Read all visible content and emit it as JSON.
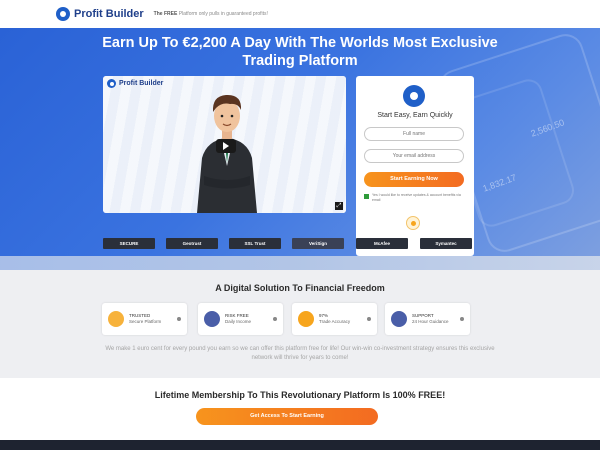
{
  "brand": {
    "name": "Profit Builder",
    "tagline_strong": "The FREE",
    "tagline_rest": "Platform only pulls in guaranteed profits!"
  },
  "hero": {
    "title_line1": "Earn Up To €2,200 A Day With The Worlds Most Exclusive",
    "title_line2": "Trading Platform",
    "deco_numbers": [
      "2,560.50",
      "1,832.17"
    ]
  },
  "video": {
    "logo_text": "Profit Builder"
  },
  "form": {
    "title": "Start Easy, Earn Quickly",
    "name_placeholder": "Full name",
    "email_placeholder": "Your email address",
    "submit_label": "Start Earning Now",
    "consent_text": "Yes I would like to receive updates & account benefits via email"
  },
  "trust_logos": [
    "SECURE",
    "Geotrust",
    "SSL Trust",
    "VeriSign",
    "McAfee",
    "Symantec"
  ],
  "features_section": {
    "title": "A Digital Solution To Financial Freedom",
    "features": [
      {
        "title": "TRUSTED",
        "subtitle": "Secure Platform"
      },
      {
        "title": "RISK FREE",
        "subtitle": "Daily Income"
      },
      {
        "title": "97%",
        "subtitle": "Trade Accuracy"
      },
      {
        "title": "SUPPORT",
        "subtitle": "24 Hour Guidance"
      }
    ],
    "paragraph": "We make 1 euro cent for every pound you earn so we can offer this platform free for life! Our win-win co-investment strategy ensures this exclusive network will thrive for years to come!"
  },
  "membership": {
    "title": "Lifetime Membership To This Revolutionary Platform Is 100% FREE!",
    "cta_label": "Get Access To Start Earning"
  },
  "colors": {
    "accent": "#f7941d",
    "brand_blue": "#1f5fc8"
  }
}
